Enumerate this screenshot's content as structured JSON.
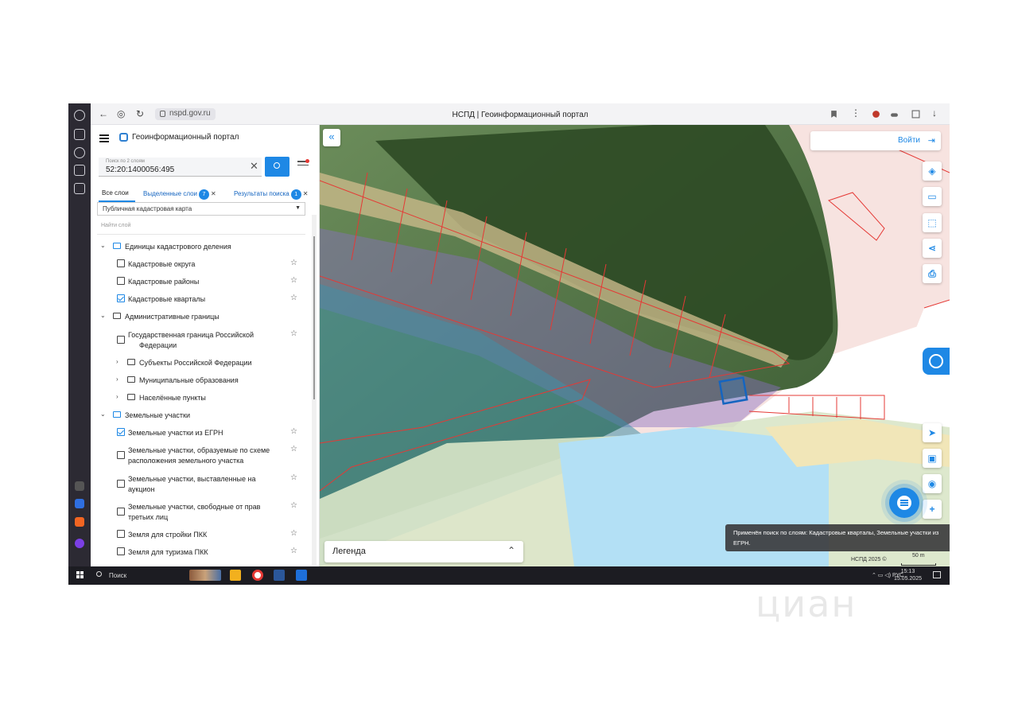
{
  "browser": {
    "url": "nspd.gov.ru",
    "title": "НСПД | Геоинформационный портал"
  },
  "panel": {
    "portal_title": "Геоинформационный портал",
    "search_label": "Поиск по 2 слоям",
    "search_value": "52:20:1400056:495",
    "tabs": {
      "all": "Все слои",
      "selected": "Выделенные слои",
      "selected_count": "7",
      "results": "Результаты поиска",
      "results_count": "1"
    },
    "layer_select": "Публичная кадастровая карта",
    "layer_search_placeholder": "Найти слой",
    "tree": {
      "g1": "Единицы кадастрового деления",
      "g1_items": [
        "Кадастровые округа",
        "Кадастровые районы",
        "Кадастровые кварталы"
      ],
      "g2": "Административные границы",
      "g2_item1_a": "Государственная граница Российской",
      "g2_item1_b": "Федерации",
      "g2_sub": [
        "Субъекты Российской Федерации",
        "Муниципальные образования",
        "Населённые пункты"
      ],
      "g3": "Земельные участки",
      "g3_item1": "Земельные участки из ЕГРН",
      "g3_item2_a": "Земельные участки, образуемые по схеме",
      "g3_item2_b": "расположения земельного участка",
      "g3_item3_a": "Земельные участки, выставленные на",
      "g3_item3_b": "аукцион",
      "g3_item4_a": "Земельные участки, свободные от прав",
      "g3_item4_b": "третьих лиц",
      "g3_item5": "Земля для стройки ПКК",
      "g3_item6": "Земля для туризма ПКК"
    }
  },
  "map": {
    "login": "Войти",
    "toast_line1": "Применён поиск по слоям: Кадастровые кварталы, Земельные участки из",
    "toast_line2": "ЕГРН.",
    "legend": "Легенда",
    "copyright": "НСПД 2025 ©",
    "scale": "50 m"
  },
  "taskbar": {
    "search": "Поиск",
    "lang": "РУС",
    "time": "15:13",
    "date": "15.05.2025"
  },
  "watermark": "циан",
  "colors": {
    "accent": "#1e88e5",
    "cadastral_pink": "#f7e3e0",
    "water": "#b3e0f5",
    "parcel_red": "#e53935",
    "selected_parcel": "#1565c0"
  }
}
